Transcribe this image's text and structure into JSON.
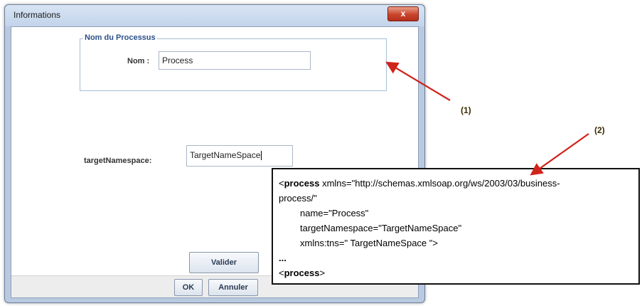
{
  "window": {
    "title": "Informations",
    "close_glyph": "x"
  },
  "group": {
    "legend": "Nom du Processus"
  },
  "name_field": {
    "label": "Nom :",
    "value": "Process"
  },
  "namespace_field": {
    "label": "targetNamespace:",
    "value": "TargetNameSpace"
  },
  "buttons": {
    "valider": "Valider",
    "ok": "OK",
    "annuler": "Annuler"
  },
  "xml": {
    "line1_tag": "process",
    "line1_rest": " xmlns=\"http://schemas.xmlsoap.org/ws/2003/03/business-",
    "line2": "process/\"",
    "line3": "name=\"Process\"",
    "line4": "targetNamespace=\"TargetNameSpace\"",
    "line5": "xmlns:tns=\" TargetNameSpace \">",
    "line6": "...",
    "line7_tag": "process",
    "line7_close": ">",
    "lt": "<"
  },
  "callouts": {
    "one": "(1)",
    "two": "(2)"
  },
  "colors": {
    "arrow": "#d0231b",
    "window_frame": "#b9c9e0",
    "close_button": "#c9452c"
  }
}
